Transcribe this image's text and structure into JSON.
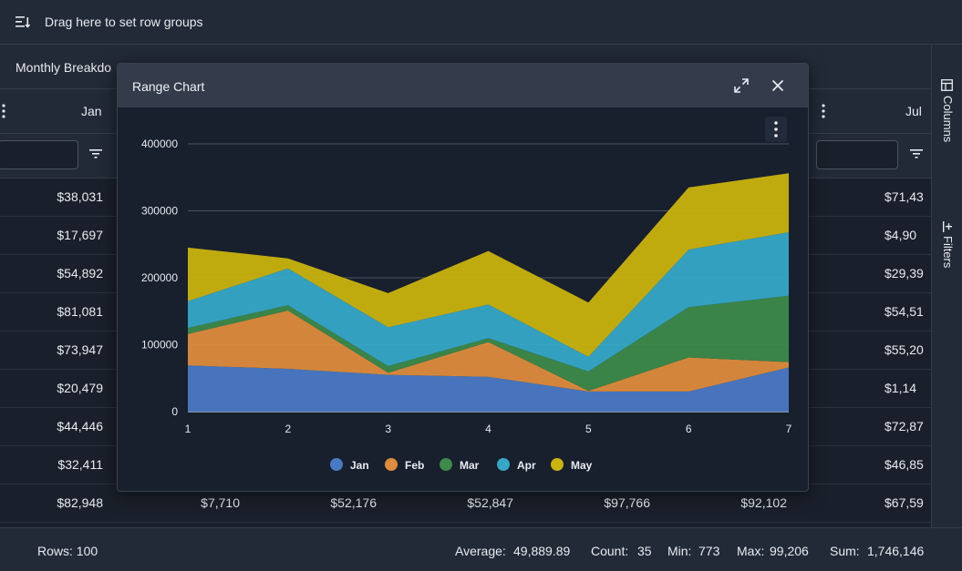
{
  "group_bar": {
    "label": "Drag here to set row groups"
  },
  "grid": {
    "group_header": "Monthly Breakdo",
    "columns": {
      "left": "Jan",
      "right": "Jul"
    },
    "rows": [
      [
        "$38,031",
        "",
        "",
        "",
        "",
        "",
        "$71,43"
      ],
      [
        "$17,697",
        "",
        "",
        "",
        "",
        "",
        "$4,90"
      ],
      [
        "$54,892",
        "",
        "",
        "",
        "",
        "",
        "$29,39"
      ],
      [
        "$81,081",
        "",
        "",
        "",
        "",
        "",
        "$54,51"
      ],
      [
        "$73,947",
        "",
        "",
        "",
        "",
        "",
        "$55,20"
      ],
      [
        "$20,479",
        "",
        "",
        "",
        "",
        "",
        "$1,14"
      ],
      [
        "$44,446",
        "",
        "",
        "",
        "",
        "",
        "$72,87"
      ],
      [
        "$32,411",
        "",
        "",
        "",
        "",
        "",
        "$46,85"
      ],
      [
        "$82,948",
        "$7,710",
        "$52,176",
        "$52,847",
        "$97,766",
        "$92,102",
        "$67,59"
      ]
    ]
  },
  "side_panel": {
    "columns_label": "Columns",
    "filters_label": "Filters"
  },
  "status": {
    "rows": "Rows: 100",
    "average_label": "Average:",
    "average": "49,889.89",
    "count_label": "Count:",
    "count": "35",
    "min_label": "Min:",
    "min": "773",
    "max_label": "Max:",
    "max": "99,206",
    "sum_label": "Sum:",
    "sum": "1,746,146"
  },
  "dialog": {
    "title": "Range Chart"
  },
  "chart_data": {
    "type": "area",
    "stacked": true,
    "x": [
      1,
      2,
      3,
      4,
      5,
      6,
      7
    ],
    "ylim": [
      0,
      400000
    ],
    "yticks": [
      0,
      100000,
      200000,
      300000,
      400000
    ],
    "ytick_labels": [
      "0",
      "100000",
      "200000",
      "300000",
      "400000"
    ],
    "grid": true,
    "legend": "bottom",
    "series": [
      {
        "name": "Jan",
        "color": "#4a79c4",
        "values": [
          69000,
          64000,
          55000,
          52000,
          30000,
          30000,
          66000
        ]
      },
      {
        "name": "Feb",
        "color": "#dd8c3c",
        "values": [
          47000,
          87000,
          3000,
          52000,
          1000,
          51000,
          8000
        ]
      },
      {
        "name": "Mar",
        "color": "#3d8a4a",
        "values": [
          9000,
          8000,
          10000,
          6000,
          29000,
          75000,
          99000
        ]
      },
      {
        "name": "Apr",
        "color": "#35a8c8",
        "values": [
          40000,
          55000,
          58000,
          50000,
          22000,
          86000,
          95000
        ]
      },
      {
        "name": "May",
        "color": "#c9b30e",
        "values": [
          80000,
          15000,
          51000,
          80000,
          81000,
          93000,
          88000
        ]
      }
    ]
  }
}
